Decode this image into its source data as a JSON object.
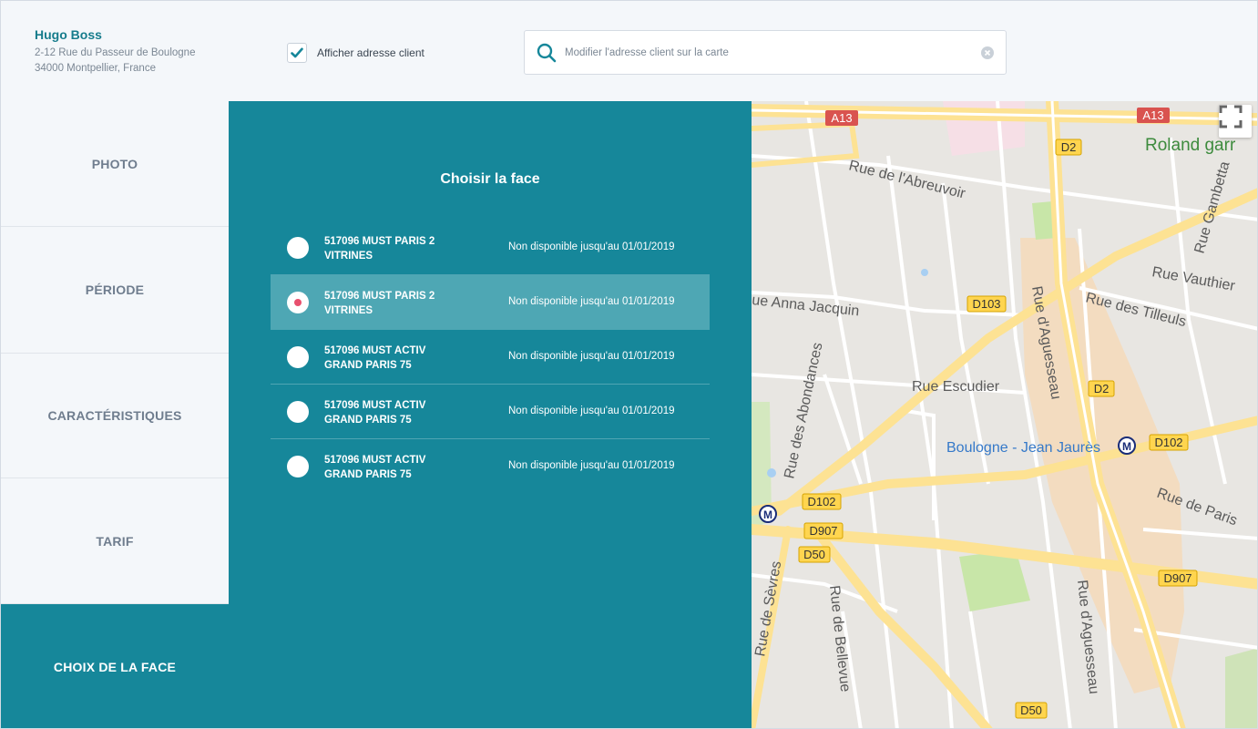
{
  "client": {
    "name": "Hugo Boss",
    "address_line1": "2-12 Rue du Passeur de Boulogne",
    "address_line2": "34000 Montpellier, France"
  },
  "show_address": {
    "label": "Afficher adresse client",
    "checked": true
  },
  "search": {
    "placeholder": "Modifier l'adresse client sur la carte",
    "value": ""
  },
  "nav": {
    "items": [
      {
        "label": "PHOTO",
        "active": false
      },
      {
        "label": "PÉRIODE",
        "active": false
      },
      {
        "label": "CARACTÉRISTIQUES",
        "active": false
      },
      {
        "label": "TARIF",
        "active": false
      },
      {
        "label": "CHOIX DE LA FACE",
        "active": true
      }
    ]
  },
  "panel": {
    "title": "Choisir la face",
    "faces": [
      {
        "line1": "517096 MUST PARIS 2",
        "line2": "VITRINES",
        "status": "Non disponible jusqu'au 01/01/2019",
        "selected": false
      },
      {
        "line1": "517096 MUST PARIS 2",
        "line2": "VITRINES",
        "status": "Non disponible jusqu'au 01/01/2019",
        "selected": true
      },
      {
        "line1": "517096 MUST  ACTIV",
        "line2": "GRAND PARIS 75",
        "status": "Non disponible jusqu'au 01/01/2019",
        "selected": false
      },
      {
        "line1": "517096 MUST  ACTIV",
        "line2": "GRAND PARIS 75",
        "status": "Non disponible jusqu'au 01/01/2019",
        "selected": false
      },
      {
        "line1": "517096 MUST  ACTIV",
        "line2": "GRAND PARIS 75",
        "status": "Non disponible jusqu'au 01/01/2019",
        "selected": false
      }
    ]
  },
  "map": {
    "road_labels": {
      "a13_left": "A13",
      "a13_right": "A13",
      "d2_top": "D2",
      "d103": "D103",
      "d2_mid": "D2",
      "d102_right": "D102",
      "d102_left": "D102",
      "d907_left": "D907",
      "d50_left": "D50",
      "d907_right": "D907",
      "d50_bottom": "D50"
    },
    "street_labels": {
      "roland_garros": "Roland garr",
      "abreuvoir": "Rue de l'Abreuvoir",
      "gambetta": "Rue Gambetta",
      "vauthier": "Rue Vauthier",
      "anna_jacquin": "ue Anna Jacquin",
      "tilleuls": "Rue des Tilleuls",
      "abondances": "Rue des Abondances",
      "aguesseau_top": "Rue d'Aguesseau",
      "escudier": "Rue Escudier",
      "boulogne_jean_jaures": "Boulogne - Jean Jaurès",
      "rue_de_paris": "Rue de Paris",
      "sevres": "Rue de Sèvres",
      "bellevue": "Rue de Bellevue",
      "aguesseau_bottom": "Rue d'Aguesseau"
    },
    "metro_symbol": "M",
    "colors": {
      "background": "#e5e3df",
      "major_road": "#fde293",
      "minor_road": "#ffffff",
      "park": "#c8e6a8",
      "highway_shield": "#ffd54f",
      "a_road_shield": "#d9534f"
    }
  },
  "colors": {
    "accent": "#16879a",
    "selected_row": "#4ea7b4",
    "radio_dot": "#e8506e",
    "client_name": "#167c8c"
  }
}
